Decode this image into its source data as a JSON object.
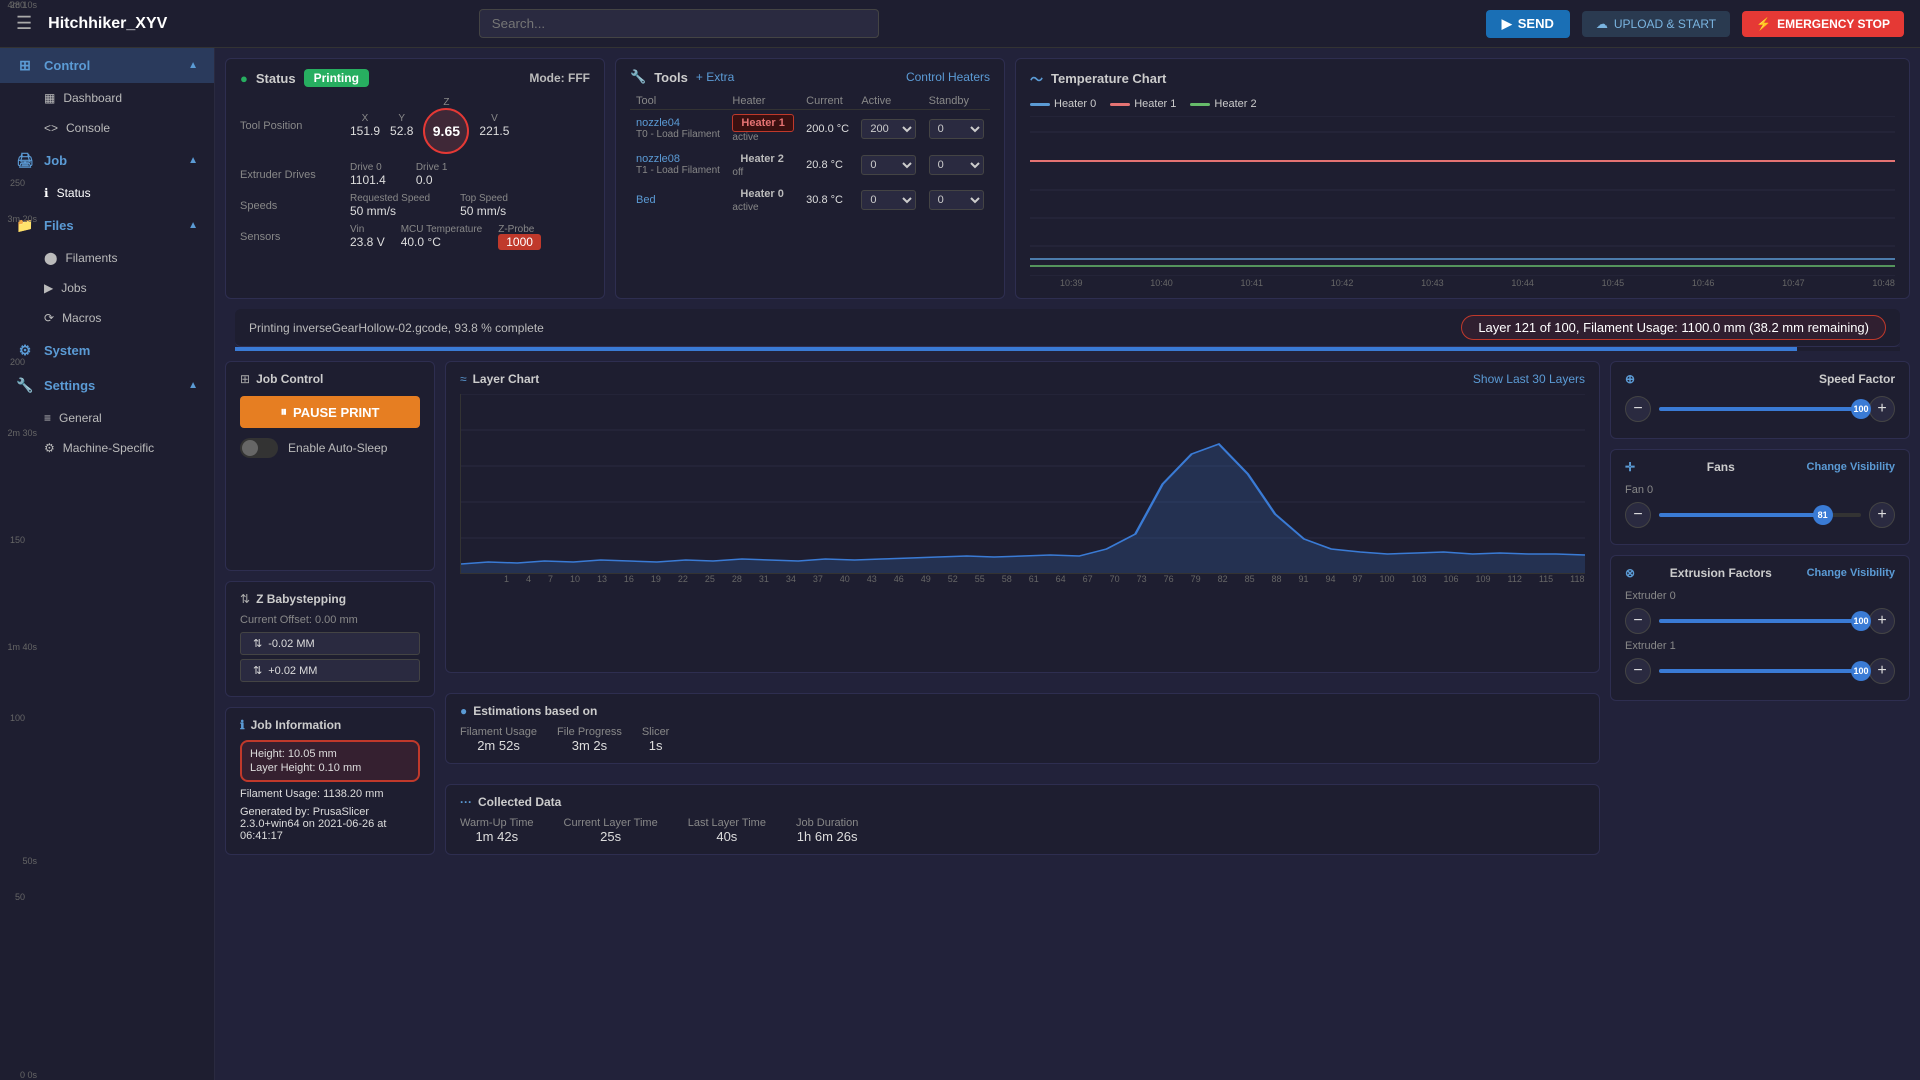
{
  "topbar": {
    "menu_icon": "☰",
    "title": "Hitchhiker_XYV",
    "search_placeholder": "Search...",
    "send_label": "SEND",
    "upload_label": "UPLOAD & START",
    "emergency_label": "EMERGENCY STOP"
  },
  "sidebar": {
    "sections": [
      {
        "name": "Control",
        "icon": "⊞",
        "active": true,
        "expanded": true,
        "items": [
          {
            "name": "Dashboard",
            "icon": "▦"
          },
          {
            "name": "Console",
            "icon": "<>"
          }
        ]
      },
      {
        "name": "Job",
        "icon": "🖨",
        "active": false,
        "expanded": true,
        "items": [
          {
            "name": "Status",
            "icon": "ℹ",
            "active": true
          },
          {
            "name": "Filaments",
            "icon": "⬤"
          },
          {
            "name": "Jobs",
            "icon": "▶"
          },
          {
            "name": "Macros",
            "icon": "⟳"
          }
        ]
      },
      {
        "name": "Files",
        "icon": "📁",
        "active": false,
        "expanded": true,
        "items": []
      },
      {
        "name": "System",
        "icon": "⚙",
        "active": false,
        "expanded": false,
        "items": []
      },
      {
        "name": "Settings",
        "icon": "🔧",
        "active": false,
        "expanded": true,
        "items": [
          {
            "name": "General",
            "icon": "≡"
          },
          {
            "name": "Machine-Specific",
            "icon": "⚙"
          }
        ]
      }
    ]
  },
  "status": {
    "title": "Status",
    "badge": "Printing",
    "mode": "Mode: FFF",
    "tool_position_label": "Tool Position",
    "x_label": "X",
    "x_value": "151.9",
    "y_label": "Y",
    "y_value": "52.8",
    "z_label": "Z",
    "z_value": "9.65",
    "v_label": "V",
    "v_value": "221.5",
    "extruder_drives_label": "Extruder Drives",
    "drive0_label": "Drive 0",
    "drive0_value": "1101.4",
    "drive1_label": "Drive 1",
    "drive1_value": "0.0",
    "speeds_label": "Speeds",
    "req_speed_label": "Requested Speed",
    "req_speed_value": "50 mm/s",
    "top_speed_label": "Top Speed",
    "top_speed_value": "50 mm/s",
    "sensors_label": "Sensors",
    "vin_label": "Vin",
    "vin_value": "23.8 V",
    "mcu_label": "MCU Temperature",
    "mcu_value": "40.0 °C",
    "zprobe_label": "Z-Probe",
    "zprobe_value": "1000"
  },
  "tools": {
    "title": "Tools",
    "plus": "+ Extra",
    "control": "Control Heaters",
    "headers": [
      "Tool",
      "Heater",
      "Current",
      "Active",
      "Standby"
    ],
    "rows": [
      {
        "tool_link": "nozzle04",
        "tool_sub": "T0 - Load Filament",
        "heater_name": "Heater 1",
        "heater_class": "heater-red",
        "heater_status": "active",
        "current": "200.0 °C",
        "active": "200",
        "standby": "0"
      },
      {
        "tool_link": "nozzle08",
        "tool_sub": "T1 - Load Filament",
        "heater_name": "Heater 2",
        "heater_class": "heater-gray",
        "heater_status": "off",
        "current": "20.8 °C",
        "active": "0",
        "standby": "0"
      },
      {
        "tool_link": "Bed",
        "tool_sub": "",
        "heater_name": "Heater 0",
        "heater_class": "heater-gray",
        "heater_status": "active",
        "current": "30.8 °C",
        "active": "0",
        "standby": "0"
      }
    ]
  },
  "temp_chart": {
    "title": "Temperature Chart",
    "legend": [
      {
        "label": "Heater 0",
        "color": "#5b9bd5"
      },
      {
        "label": "Heater 1",
        "color": "#e57373"
      },
      {
        "label": "Heater 2",
        "color": "#66bb6a"
      }
    ],
    "y_labels": [
      "280",
      "250",
      "200",
      "150",
      "100",
      "50",
      "0"
    ],
    "x_labels": [
      "10:39",
      "10:40",
      "10:41",
      "10:42",
      "10:43",
      "10:44",
      "10:45",
      "10:46",
      "10:47",
      "10:48"
    ]
  },
  "progress": {
    "text": "Printing inverseGearHollow-02.gcode, 93.8 % complete",
    "layer_info": "Layer 121 of 100, Filament Usage: 1100.0 mm (38.2 mm remaining)"
  },
  "job_control": {
    "title": "Job Control",
    "pause_label": "PAUSE PRINT",
    "auto_sleep_label": "Enable Auto-Sleep",
    "zbaby_title": "Z Babystepping",
    "zbaby_offset": "Current Offset: 0.00 mm",
    "zbaby_minus": "-0.02 MM",
    "zbaby_plus": "+0.02 MM",
    "job_info_title": "Job Information",
    "height_label": "Height:",
    "height_value": "10.05 mm",
    "layer_height_label": "Layer Height:",
    "layer_height_value": "0.10 mm",
    "filament_usage_label": "Filament Usage:",
    "filament_usage_value": "1138.20 mm",
    "generated_label": "Generated by:",
    "generated_value": "PrusaSlicer 2.3.0+win64 on 2021-06-26 at 06:41:17"
  },
  "layer_chart": {
    "title": "Layer Chart",
    "show_layers": "Show Last 30 Layers",
    "y_labels": [
      "4m 10s",
      "3m 20s",
      "2m 30s",
      "1m 40s",
      "50s",
      "0s"
    ],
    "x_labels": [
      "1",
      "4",
      "7",
      "10",
      "13",
      "16",
      "19",
      "22",
      "25",
      "28",
      "31",
      "34",
      "37",
      "40",
      "43",
      "46",
      "49",
      "52",
      "55",
      "58",
      "61",
      "64",
      "67",
      "70",
      "73",
      "76",
      "79",
      "82",
      "85",
      "88",
      "91",
      "94",
      "97",
      "100",
      "103",
      "106",
      "109",
      "112",
      "115",
      "118"
    ]
  },
  "estimations": {
    "title": "Estimations based on",
    "items": [
      {
        "label": "Filament Usage",
        "value": "2m 52s"
      },
      {
        "label": "File Progress",
        "value": "3m 2s"
      },
      {
        "label": "Slicer",
        "value": "1s"
      }
    ]
  },
  "collected": {
    "title": "Collected Data",
    "items": [
      {
        "label": "Warm-Up Time",
        "value": "1m 42s"
      },
      {
        "label": "Current Layer Time",
        "value": "25s"
      },
      {
        "label": "Last Layer Time",
        "value": "40s"
      },
      {
        "label": "Job Duration",
        "value": "1h 6m 26s"
      }
    ]
  },
  "speed_factor": {
    "title": "Speed Factor",
    "value": 100
  },
  "fans": {
    "title": "Fans",
    "change_vis": "Change Visibility",
    "fan0_label": "Fan 0",
    "fan0_value": 81
  },
  "extrusion": {
    "title": "Extrusion Factors",
    "change_vis": "Change Visibility",
    "extruder0_label": "Extruder 0",
    "extruder0_value": 100,
    "extruder1_label": "Extruder 1",
    "extruder1_value": 100
  }
}
